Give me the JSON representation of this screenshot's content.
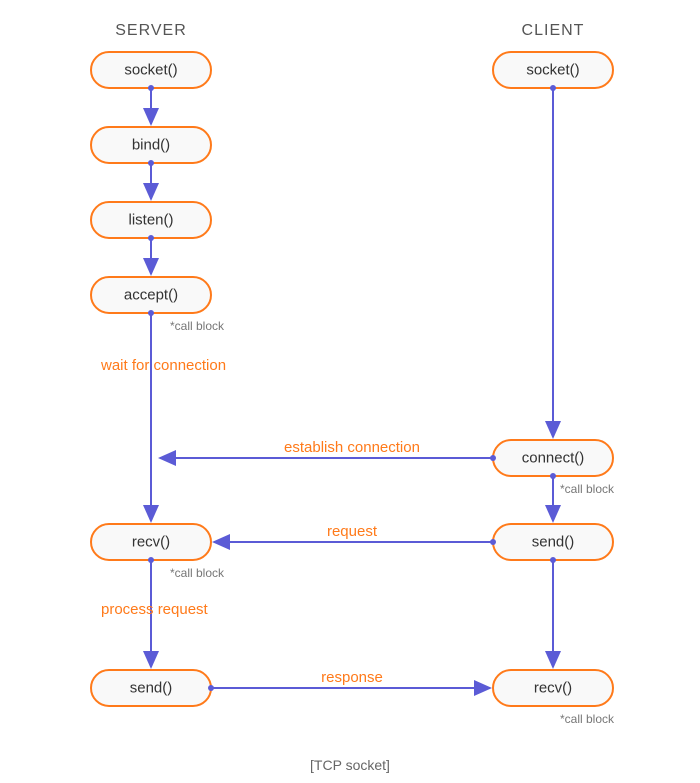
{
  "diagram": {
    "headers": {
      "server": "SERVER",
      "client": "CLIENT"
    },
    "server_nodes": {
      "socket": "socket()",
      "bind": "bind()",
      "listen": "listen()",
      "accept": "accept()",
      "recv": "recv()",
      "send": "send()"
    },
    "client_nodes": {
      "socket": "socket()",
      "connect": "connect()",
      "send": "send()",
      "recv": "recv()"
    },
    "notes": {
      "accept_block": "*call block",
      "connect_block": "*call block",
      "recv_server_block": "*call block",
      "recv_client_block": "*call block"
    },
    "events": {
      "wait": "wait for connection",
      "establish": "establish connection",
      "request": "request",
      "process": "process request",
      "response": "response"
    },
    "caption": "[TCP socket]"
  },
  "colors": {
    "node_stroke": "#ff7a1a",
    "node_fill": "#f9f9f9",
    "arrow": "#5b5bd6",
    "event_text": "#ff7a1a",
    "note_text": "#777777"
  },
  "chart_data": {
    "type": "flow-diagram",
    "title": "[TCP socket]",
    "columns": [
      "SERVER",
      "CLIENT"
    ],
    "nodes": [
      {
        "id": "s_socket",
        "column": "SERVER",
        "label": "socket()"
      },
      {
        "id": "s_bind",
        "column": "SERVER",
        "label": "bind()"
      },
      {
        "id": "s_listen",
        "column": "SERVER",
        "label": "listen()"
      },
      {
        "id": "s_accept",
        "column": "SERVER",
        "label": "accept()",
        "note": "*call block"
      },
      {
        "id": "s_recv",
        "column": "SERVER",
        "label": "recv()",
        "note": "*call block"
      },
      {
        "id": "s_send",
        "column": "SERVER",
        "label": "send()"
      },
      {
        "id": "c_socket",
        "column": "CLIENT",
        "label": "socket()"
      },
      {
        "id": "c_connect",
        "column": "CLIENT",
        "label": "connect()",
        "note": "*call block"
      },
      {
        "id": "c_send",
        "column": "CLIENT",
        "label": "send()"
      },
      {
        "id": "c_recv",
        "column": "CLIENT",
        "label": "recv()",
        "note": "*call block"
      }
    ],
    "edges": [
      {
        "from": "s_socket",
        "to": "s_bind"
      },
      {
        "from": "s_bind",
        "to": "s_listen"
      },
      {
        "from": "s_listen",
        "to": "s_accept"
      },
      {
        "from": "s_accept",
        "to": "s_recv",
        "label": "wait for connection"
      },
      {
        "from": "s_recv",
        "to": "s_send",
        "label": "process request"
      },
      {
        "from": "c_socket",
        "to": "c_connect"
      },
      {
        "from": "c_connect",
        "to": "s_accept",
        "label": "establish connection"
      },
      {
        "from": "c_connect",
        "to": "c_send"
      },
      {
        "from": "c_send",
        "to": "s_recv",
        "label": "request"
      },
      {
        "from": "c_send",
        "to": "c_recv"
      },
      {
        "from": "s_send",
        "to": "c_recv",
        "label": "response"
      }
    ]
  }
}
